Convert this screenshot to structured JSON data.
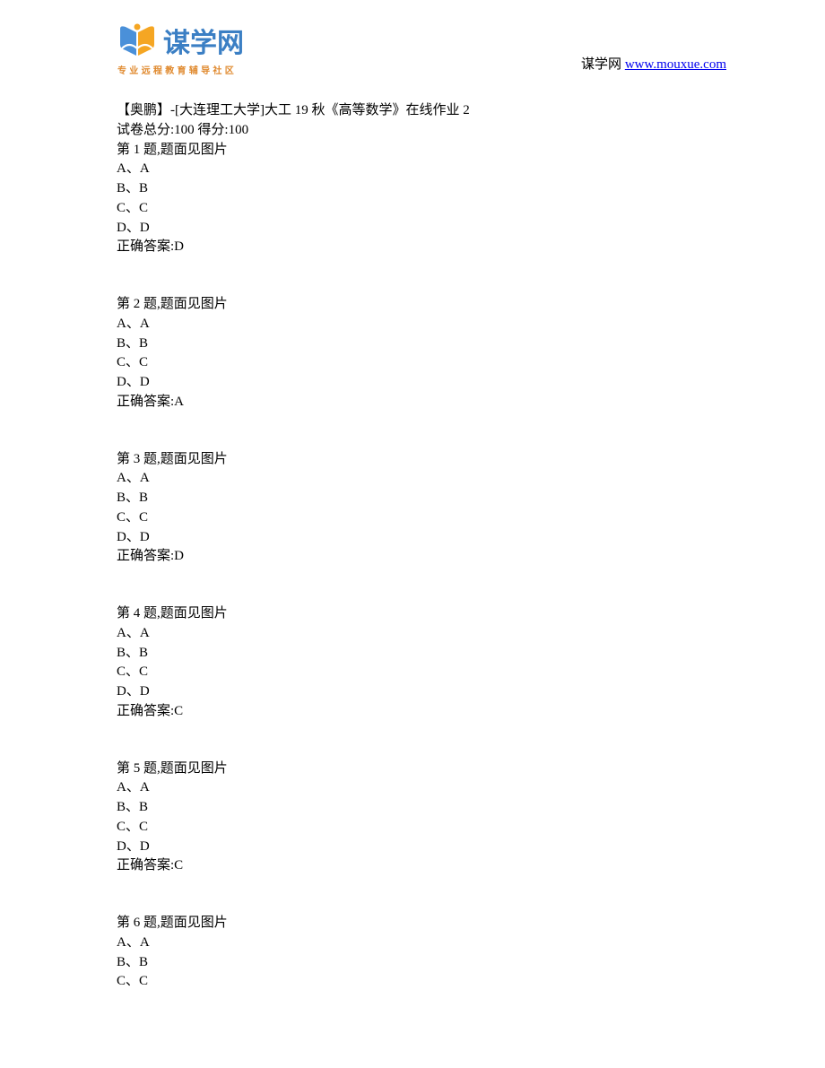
{
  "header": {
    "logo_text": "谋学网",
    "logo_subtitle": "专业远程教育辅导社区",
    "site_label": "谋学网 ",
    "site_url": "www.mouxue.com"
  },
  "document": {
    "title": "【奥鹏】-[大连理工大学]大工 19 秋《高等数学》在线作业 2",
    "score_line": "试卷总分:100     得分:100",
    "questions": [
      {
        "header": "第 1 题,题面见图片",
        "options": [
          "A、A",
          "B、B",
          "C、C",
          "D、D"
        ],
        "answer": "正确答案:D"
      },
      {
        "header": "第 2 题,题面见图片",
        "options": [
          "A、A",
          "B、B",
          "C、C",
          "D、D"
        ],
        "answer": "正确答案:A"
      },
      {
        "header": "第 3 题,题面见图片",
        "options": [
          "A、A",
          "B、B",
          "C、C",
          "D、D"
        ],
        "answer": "正确答案:D"
      },
      {
        "header": "第 4 题,题面见图片",
        "options": [
          "A、A",
          "B、B",
          "C、C",
          "D、D"
        ],
        "answer": "正确答案:C"
      },
      {
        "header": "第 5 题,题面见图片",
        "options": [
          "A、A",
          "B、B",
          "C、C",
          "D、D"
        ],
        "answer": "正确答案:C"
      },
      {
        "header": "第 6 题,题面见图片",
        "options": [
          "A、A",
          "B、B",
          "C、C"
        ],
        "answer": ""
      }
    ]
  }
}
